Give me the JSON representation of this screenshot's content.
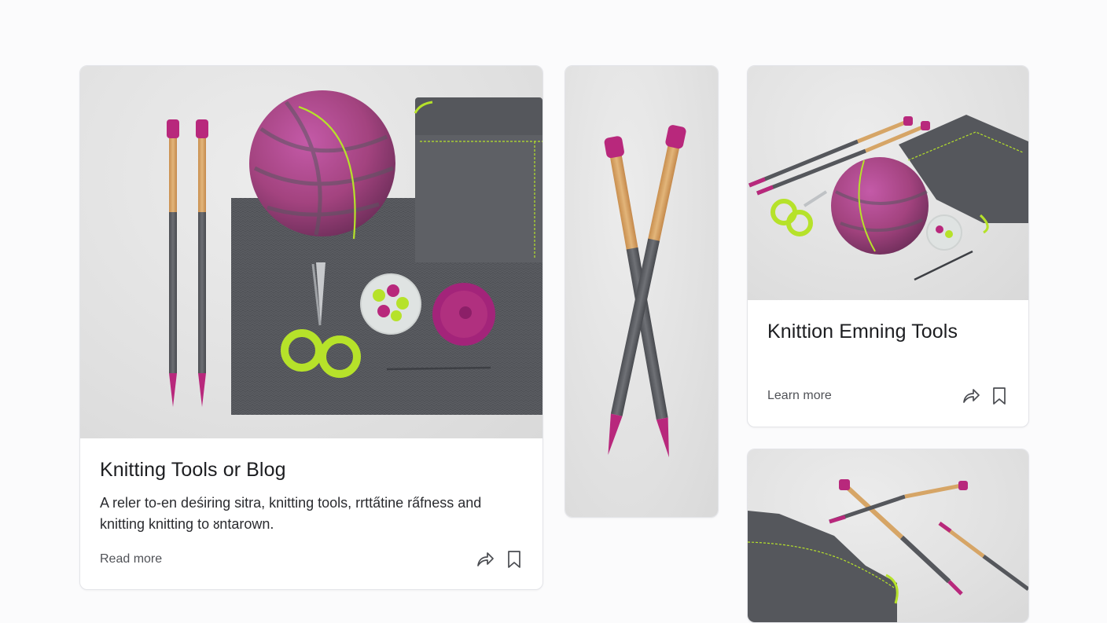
{
  "cards": [
    {
      "title": "Knitting Tools or Blog",
      "description_line1": "A reler to-en deśiring sitra, knitting tools, rrtta̋tine ra̋fness and",
      "description_line2": "knitting knitting to ᴕntarown.",
      "link_label": "Read more",
      "actions": [
        "share-icon",
        "bookmark-icon"
      ]
    },
    {
      "image_only": true
    },
    {
      "title": "Knittion Emning Tools",
      "link_label": "Learn more",
      "actions": [
        "share-icon",
        "bookmark-icon"
      ]
    },
    {
      "image_only": true
    }
  ],
  "colors": {
    "accent_magenta": "#b8287c",
    "accent_lime": "#b6e22a",
    "felt_gray": "#55575c",
    "wood": "#d6a566"
  }
}
